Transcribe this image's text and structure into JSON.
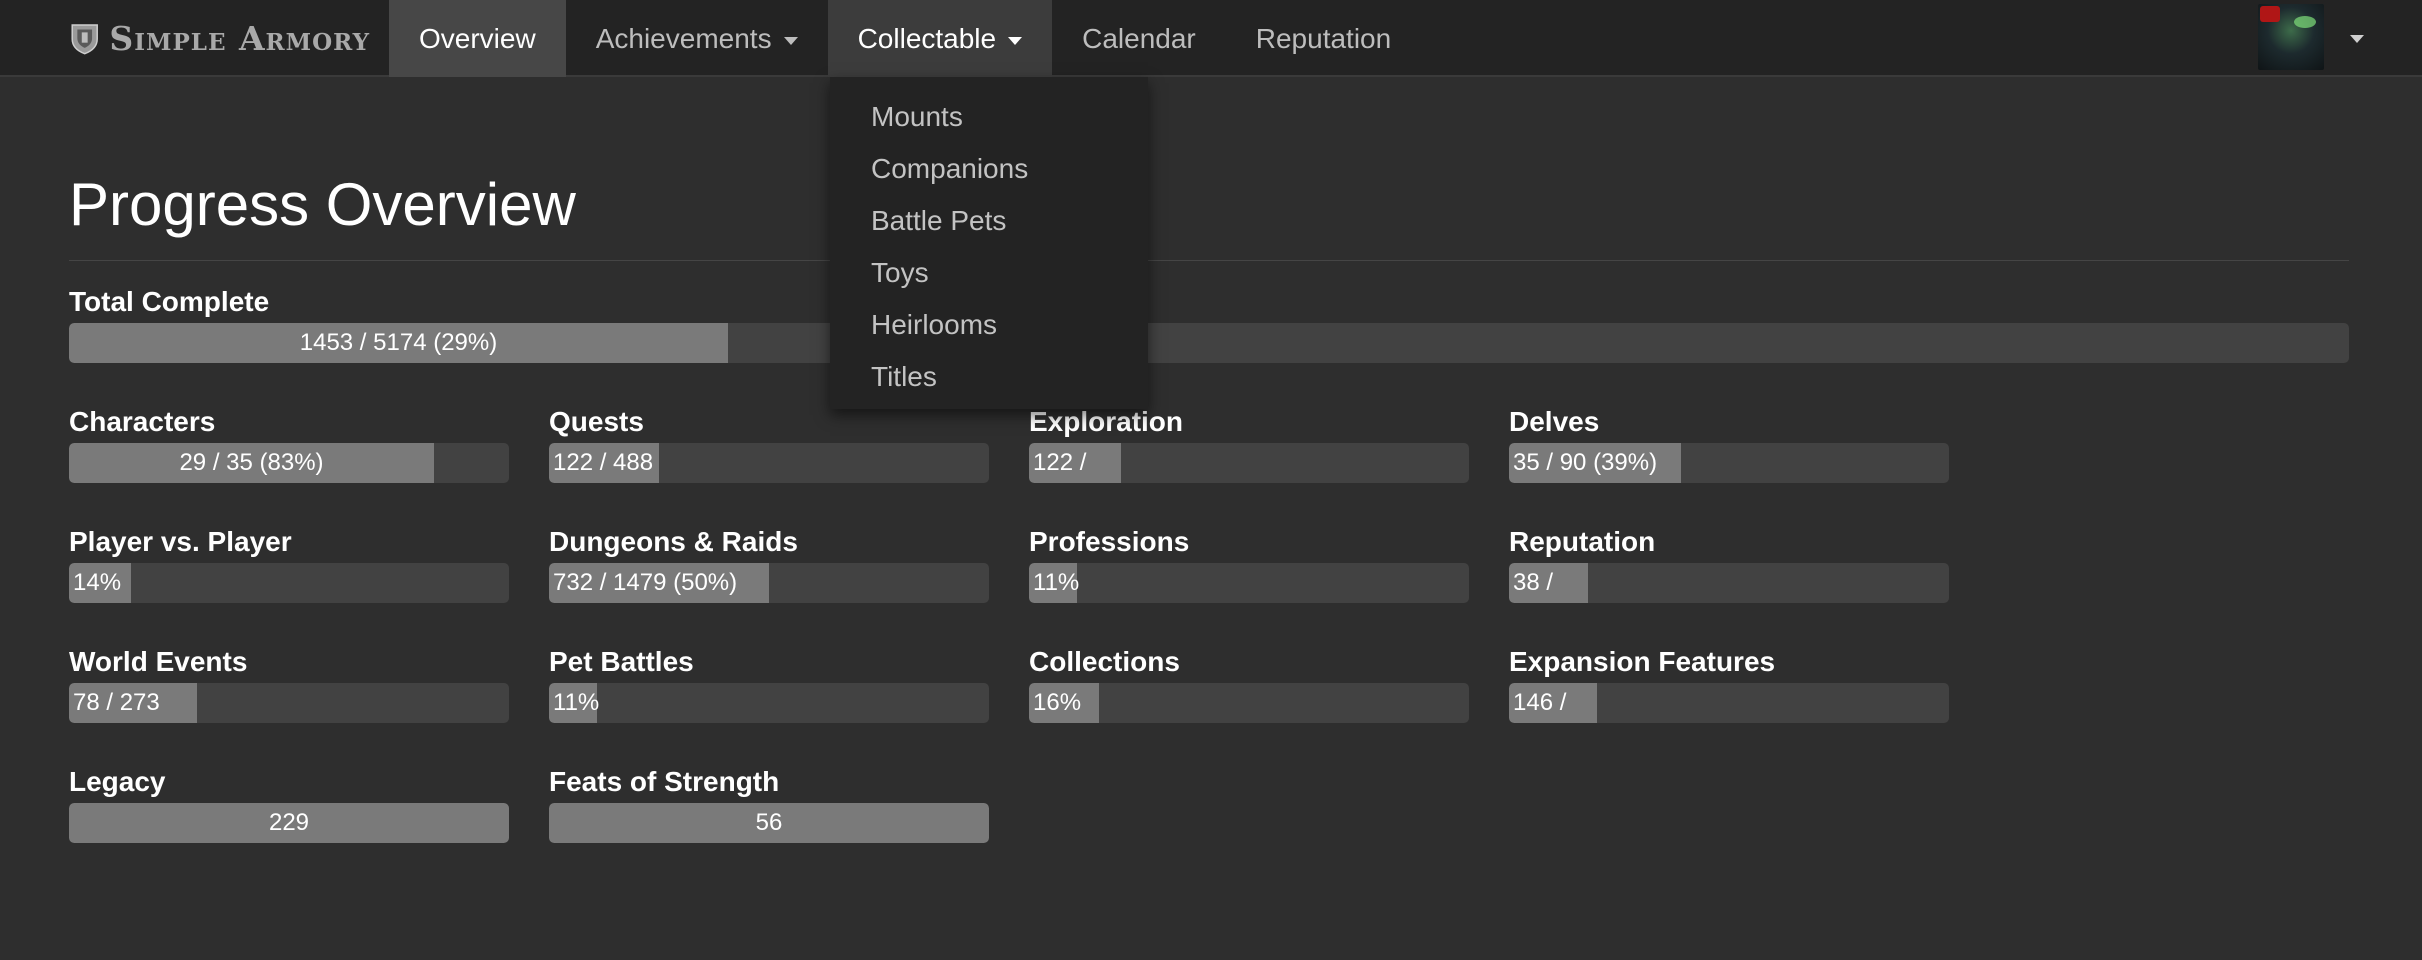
{
  "brand": {
    "name": "Simple Armory"
  },
  "nav": {
    "items": [
      {
        "label": "Overview",
        "state": "active",
        "caret": false
      },
      {
        "label": "Achievements",
        "state": "",
        "caret": true
      },
      {
        "label": "Collectable",
        "state": "open",
        "caret": true
      },
      {
        "label": "Calendar",
        "state": "",
        "caret": false
      },
      {
        "label": "Reputation",
        "state": "",
        "caret": false
      }
    ]
  },
  "dropdown": {
    "items": [
      "Mounts",
      "Companions",
      "Battle Pets",
      "Toys",
      "Heirlooms",
      "Titles"
    ]
  },
  "page": {
    "title": "Progress Overview"
  },
  "total": {
    "label": "Total Complete",
    "text": "1453 / 5174 (29%)",
    "fraction": 0.289
  },
  "stats": [
    {
      "label": "Characters",
      "text": "29 / 35 (83%)",
      "fraction": 0.83,
      "center": true
    },
    {
      "label": "Quests",
      "text": "122 / 488",
      "fraction": 0.25,
      "center": false
    },
    {
      "label": "Exploration",
      "text": "122 /",
      "fraction": 0.21,
      "center": false
    },
    {
      "label": "Delves",
      "text": "35 / 90 (39%)",
      "fraction": 0.39,
      "center": false
    },
    {
      "label": "Player vs. Player",
      "text": "14%",
      "fraction": 0.14,
      "center": false
    },
    {
      "label": "Dungeons & Raids",
      "text": "732 / 1479 (50%)",
      "fraction": 0.5,
      "center": false
    },
    {
      "label": "Professions",
      "text": "11%",
      "fraction": 0.11,
      "center": false
    },
    {
      "label": "Reputation",
      "text": "38 /",
      "fraction": 0.18,
      "center": false
    },
    {
      "label": "World Events",
      "text": "78 / 273",
      "fraction": 0.29,
      "center": false
    },
    {
      "label": "Pet Battles",
      "text": "11%",
      "fraction": 0.11,
      "center": false
    },
    {
      "label": "Collections",
      "text": "16%",
      "fraction": 0.16,
      "center": false
    },
    {
      "label": "Expansion Features",
      "text": "146 /",
      "fraction": 0.2,
      "center": false
    },
    {
      "label": "Legacy",
      "text": "229",
      "fraction": 1.0,
      "center": true
    },
    {
      "label": "Feats of Strength",
      "text": "56",
      "fraction": 1.0,
      "center": true
    }
  ],
  "colors": {
    "background": "#2e2e2e",
    "navbar": "#232323",
    "bar_track": "#424242",
    "bar_fill": "#7a7a7a"
  },
  "icons": {
    "brand": "shield-icon",
    "dropdown": "caret-down-icon"
  }
}
